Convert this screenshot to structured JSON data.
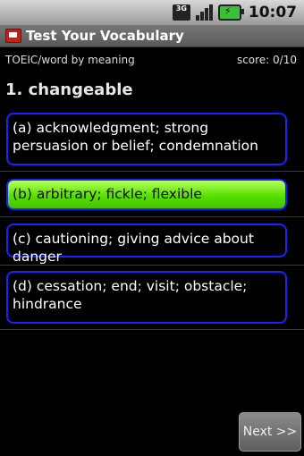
{
  "status_bar": {
    "network": "3G",
    "time": "10:07"
  },
  "app": {
    "title": "Test Your Vocabulary"
  },
  "info": {
    "category": "TOEIC/word by meaning",
    "score": "score: 0/10"
  },
  "question": {
    "text": "1. changeable"
  },
  "options": [
    {
      "label": "(a) acknowledgment; strong persuasion or belief; condemnation",
      "selected": false
    },
    {
      "label": "(b) arbitrary; fickle; flexible",
      "selected": true
    },
    {
      "label": "(c) cautioning; giving advice about danger",
      "selected": false
    },
    {
      "label": "(d) cessation; end; visit; obstacle; hindrance",
      "selected": false
    }
  ],
  "next_button": {
    "label": "Next >>"
  },
  "colors": {
    "option_border": "#1a22ff",
    "selected_fill": "#56e000"
  },
  "icons": [
    "network-3g-icon",
    "signal-icon",
    "battery-icon",
    "app-icon"
  ]
}
